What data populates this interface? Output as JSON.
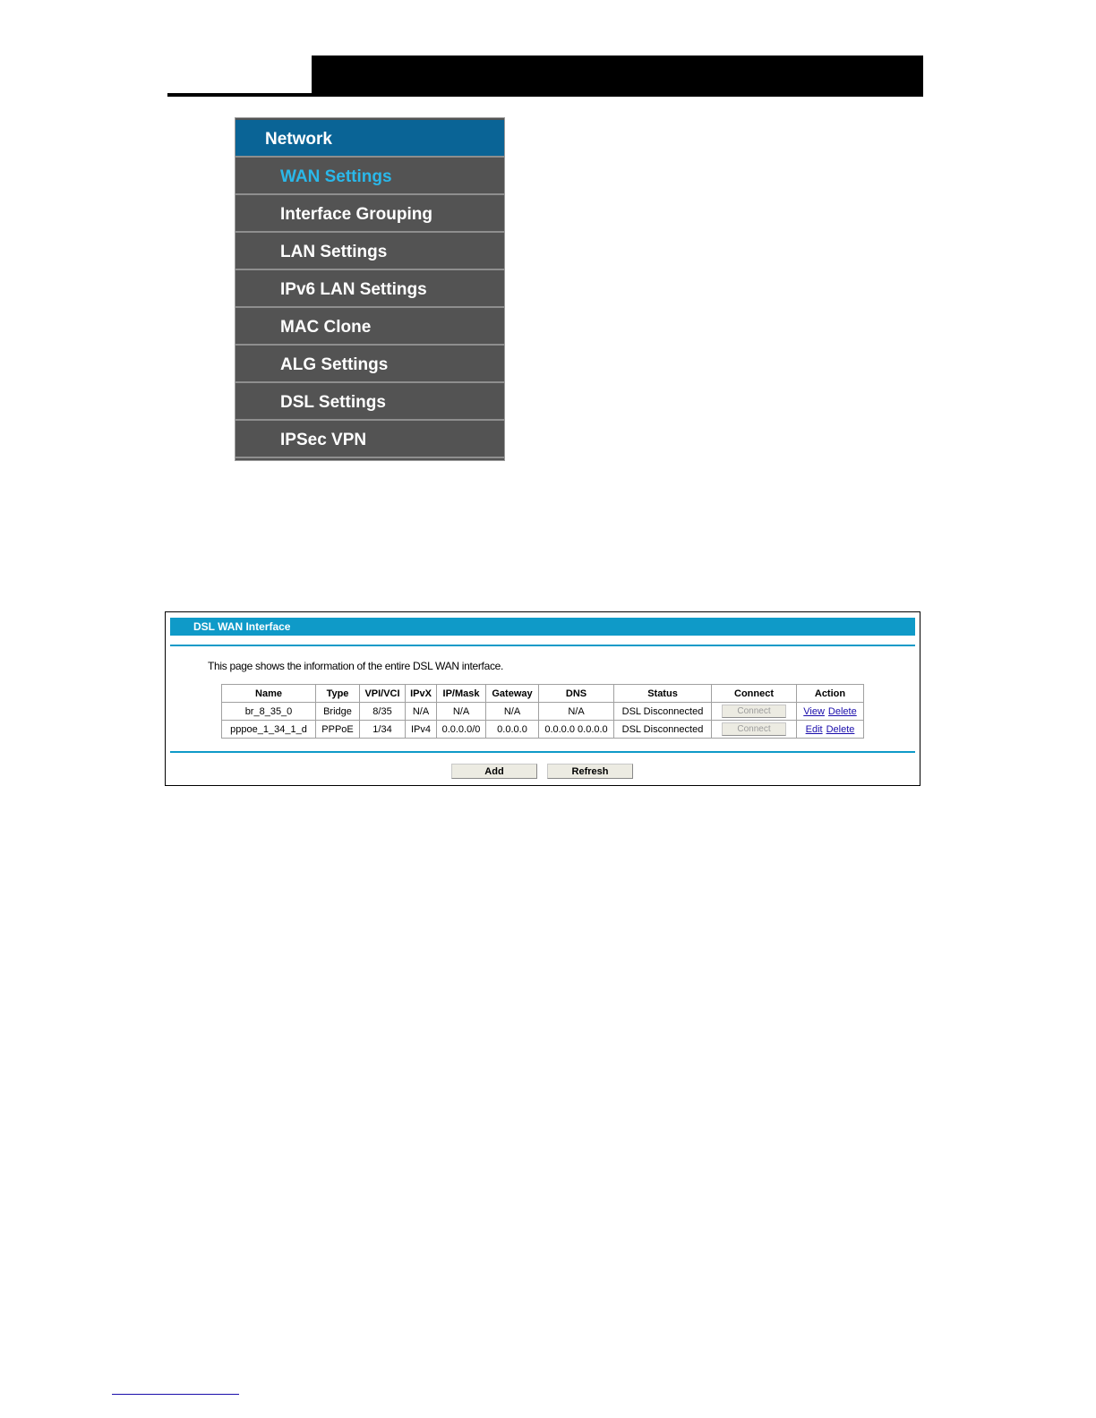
{
  "menu": {
    "header": "Network",
    "items": [
      {
        "label": "WAN Settings",
        "active": true
      },
      {
        "label": "Interface Grouping"
      },
      {
        "label": "LAN Settings"
      },
      {
        "label": "IPv6 LAN Settings"
      },
      {
        "label": "MAC Clone"
      },
      {
        "label": "ALG Settings"
      },
      {
        "label": "DSL Settings"
      },
      {
        "label": "IPSec VPN"
      }
    ]
  },
  "panel": {
    "title": "DSL WAN Interface",
    "description": "This page shows the information of the entire DSL WAN interface.",
    "columns": [
      "Name",
      "Type",
      "VPI/VCI",
      "IPvX",
      "IP/Mask",
      "Gateway",
      "DNS",
      "Status",
      "Connect",
      "Action"
    ],
    "rows": [
      {
        "name": "br_8_35_0",
        "type": "Bridge",
        "vpivci": "8/35",
        "ipvx": "N/A",
        "ipmask": "N/A",
        "gateway": "N/A",
        "dns": "N/A",
        "status": "DSL Disconnected",
        "connect": "Connect",
        "action1": "View",
        "action2": "Delete"
      },
      {
        "name": "pppoe_1_34_1_d",
        "type": "PPPoE",
        "vpivci": "1/34",
        "ipvx": "IPv4",
        "ipmask": "0.0.0.0/0",
        "gateway": "0.0.0.0",
        "dns": "0.0.0.0 0.0.0.0",
        "status": "DSL Disconnected",
        "connect": "Connect",
        "action1": "Edit",
        "action2": "Delete"
      }
    ],
    "add_label": "Add",
    "refresh_label": "Refresh"
  },
  "colors": {
    "menu_header": "#0a6496",
    "menu_bg": "#535353",
    "menu_active": "#2ab8ea",
    "panel_accent": "#0f9ac8"
  }
}
